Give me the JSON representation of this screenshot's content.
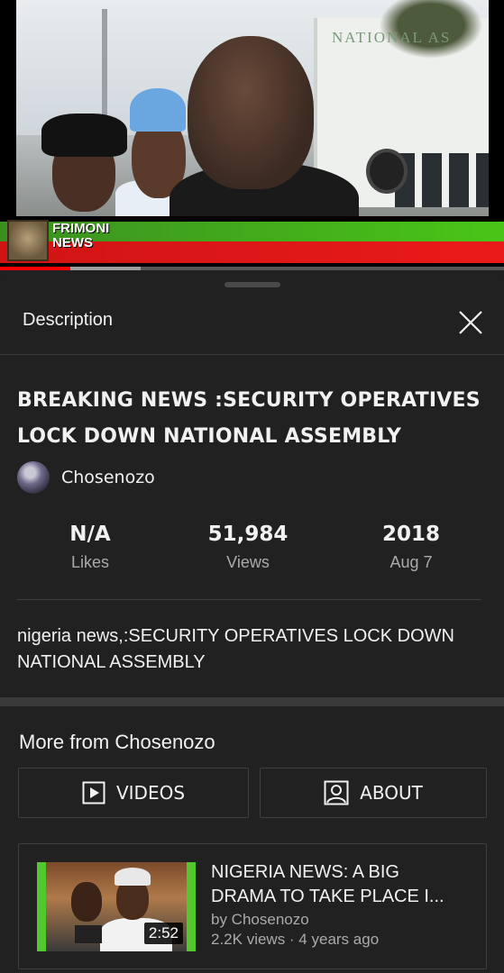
{
  "player": {
    "video_overlay_sign": "NATIONAL AS",
    "ticker_logo_line1": "FRIMONI",
    "ticker_logo_line2": "NEWS",
    "progress_fraction": 0.14,
    "buffer_fraction": 0.28
  },
  "sheet": {
    "title": "Description",
    "close_icon": "close-icon"
  },
  "video": {
    "title": "BREAKING NEWS :SECURITY OPERATIVES LOCK DOWN NATIONAL ASSEMBLY",
    "channel": "Chosenozo",
    "stats": {
      "likes_value": "N/A",
      "likes_label": "Likes",
      "views_value": "51,984",
      "views_label": "Views",
      "year_value": "2018",
      "date_label": "Aug 7"
    },
    "description": "nigeria news,:SECURITY OPERATIVES LOCK DOWN NATIONAL ASSEMBLY"
  },
  "more_from": {
    "title": "More from Chosenozo",
    "videos_button": "VIDEOS",
    "about_button": "ABOUT",
    "items": [
      {
        "title": "NIGERIA NEWS: A BIG DRAMA TO TAKE PLACE I...",
        "channel_line": "by Chosenozo",
        "meta_line": "2.2K views · 4 years ago",
        "duration": "2:52"
      }
    ]
  },
  "colors": {
    "background": "#212121",
    "progress": "#ff0000",
    "ticker_green": "#49c617",
    "ticker_red": "#ea1a1a",
    "secondary_text": "#aaaaaa"
  }
}
